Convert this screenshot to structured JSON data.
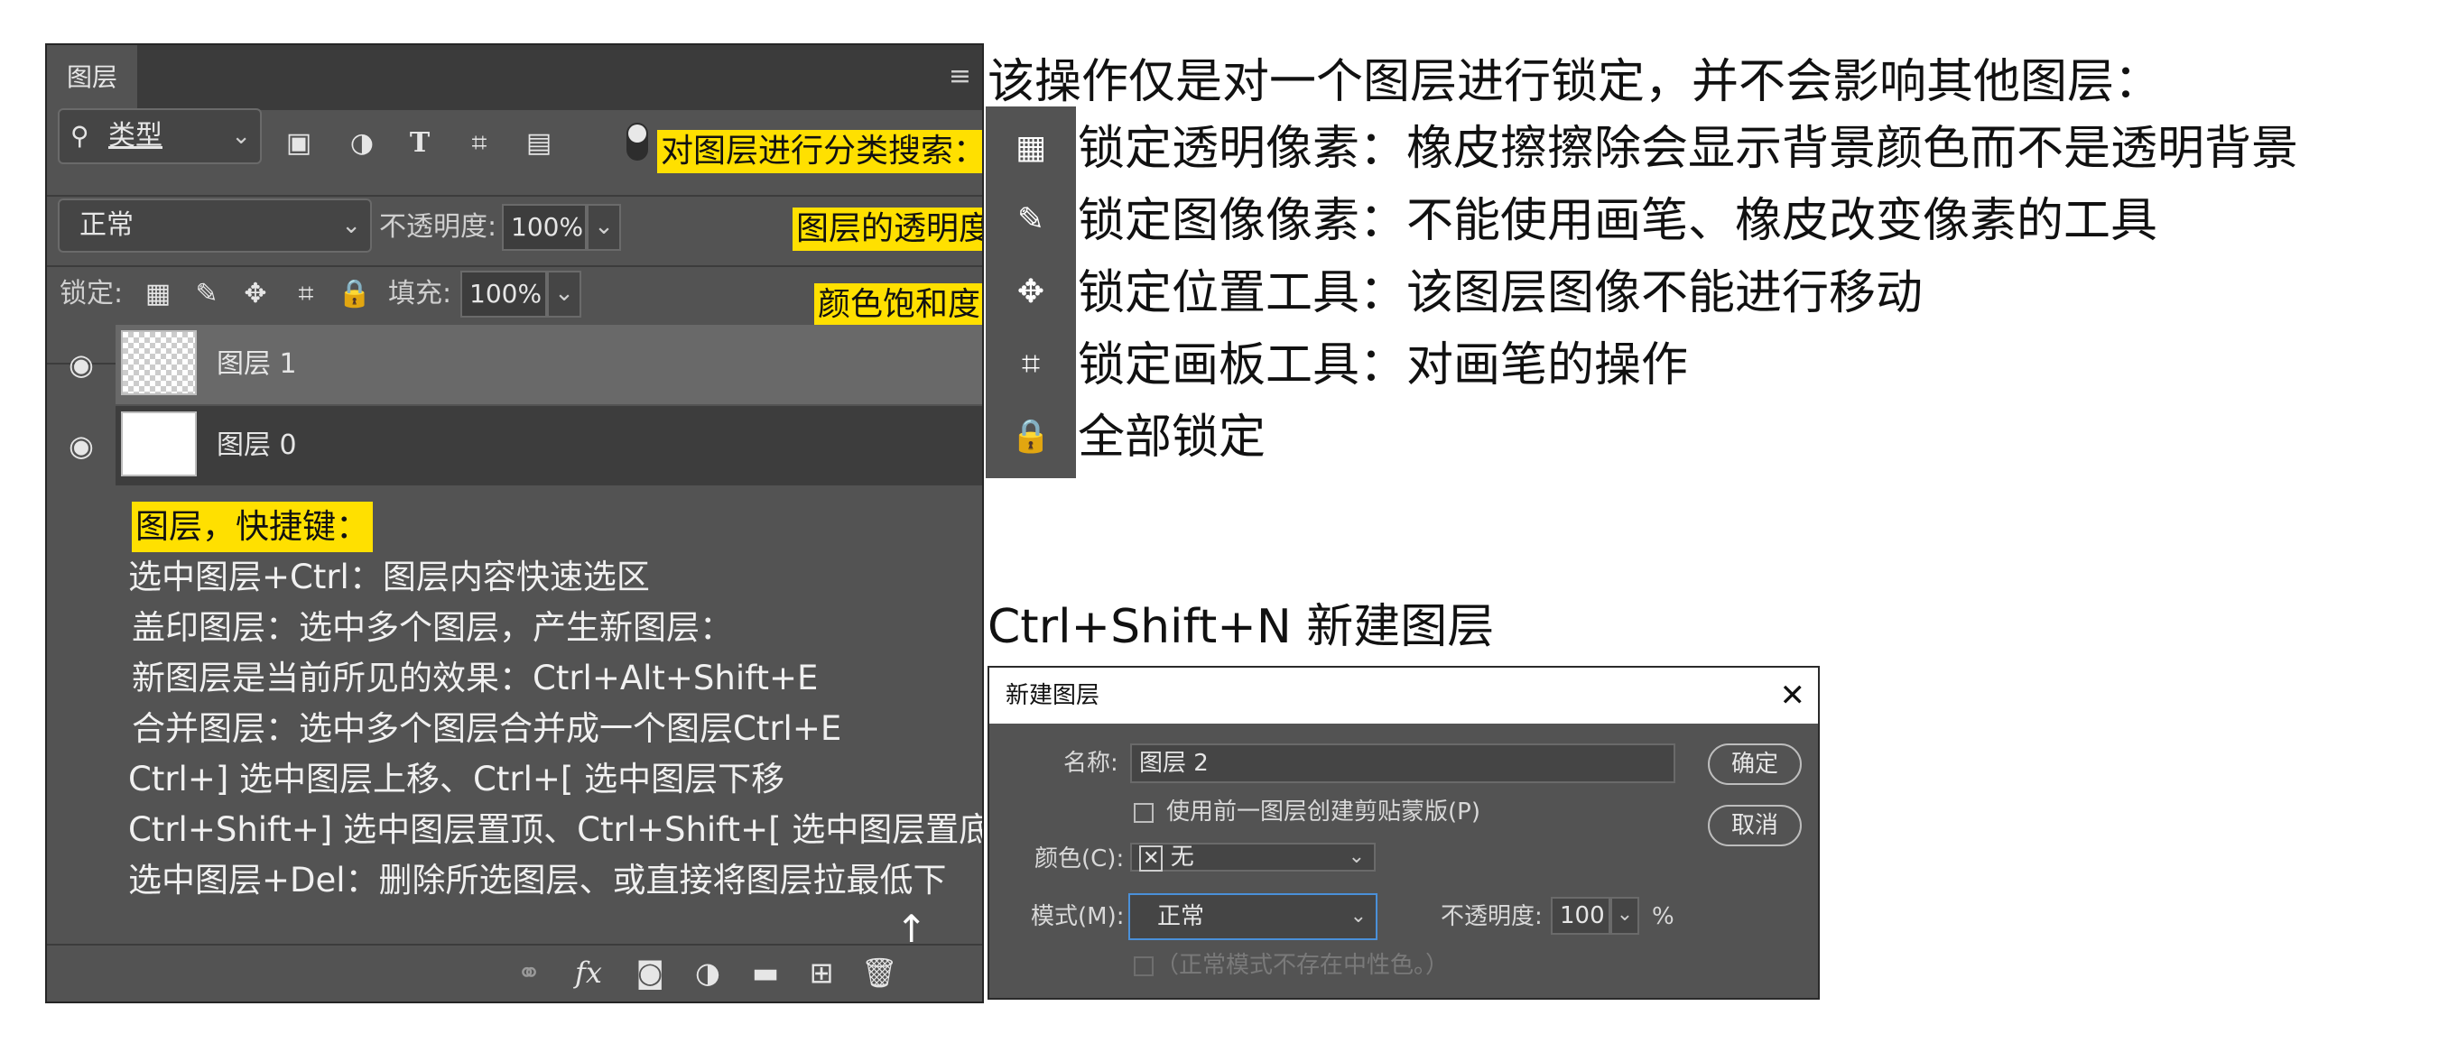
{
  "layers_panel": {
    "tab_label": "图层",
    "menu_icon": "≡",
    "kind_filter": {
      "label": "类型"
    },
    "kind_callout": "对图层进行分类搜索：",
    "blend_mode": "正常",
    "opacity_label": "不透明度:",
    "opacity_value": "100%",
    "opacity_callout": "图层的透明度",
    "lock_label": "锁定:",
    "fill_label": "填充:",
    "fill_value": "100%",
    "fill_callout": "颜色饱和度",
    "layers": [
      {
        "name": "图层 1",
        "visible": true,
        "selected": true,
        "thumbnail": "transparent"
      },
      {
        "name": "图层 0",
        "visible": true,
        "selected": false,
        "thumbnail": "white"
      }
    ],
    "notes": {
      "title": "图层，快捷键：",
      "lines": [
        "选中图层+Ctrl：图层内容快速选区",
        "盖印图层：选中多个图层，产生新图层：",
        "新图层是当前所见的效果：Ctrl+Alt+Shift+E",
        "合并图层：选中多个图层合并成一个图层Ctrl+E",
        "Ctrl+] 选中图层上移、Ctrl+[ 选中图层下移",
        "Ctrl+Shift+] 选中图层置顶、Ctrl+Shift+[ 选中图层置底",
        "选中图层+Del：删除所选图层、或直接将图层拉最低下"
      ]
    }
  },
  "lock_info": {
    "heading": "该操作仅是对一个图层进行锁定，并不会影响其他图层：",
    "items": [
      {
        "icon": "checkerboard-icon",
        "text": "锁定透明像素：橡皮擦擦除会显示背景颜色而不是透明背景"
      },
      {
        "icon": "brush-icon",
        "text": "锁定图像像素：不能使用画笔、橡皮改变像素的工具"
      },
      {
        "icon": "move-icon",
        "text": "锁定位置工具：该图层图像不能进行移动"
      },
      {
        "icon": "artboard-icon",
        "text": "锁定画板工具：对画笔的操作"
      },
      {
        "icon": "lock-icon",
        "text": "全部锁定"
      }
    ]
  },
  "new_layer": {
    "shortcut_text": "Ctrl+Shift+N 新建图层",
    "dialog": {
      "title": "新建图层",
      "name_label": "名称:",
      "name_value": "图层 2",
      "clip_label": "使用前一图层创建剪贴蒙版(P)",
      "color_label": "颜色(C):",
      "color_value": "无",
      "mode_label": "模式(M):",
      "mode_value": "正常",
      "opacity_label": "不透明度:",
      "opacity_value": "100",
      "opacity_unit": "%",
      "neutral_label": "（正常模式不存在中性色。）",
      "ok_label": "确定",
      "cancel_label": "取消"
    }
  },
  "colors": {
    "panel_bg": "#535353",
    "highlight": "#ffe000",
    "selected_layer": "#696969",
    "dialog_focus": "#4a90d9"
  }
}
